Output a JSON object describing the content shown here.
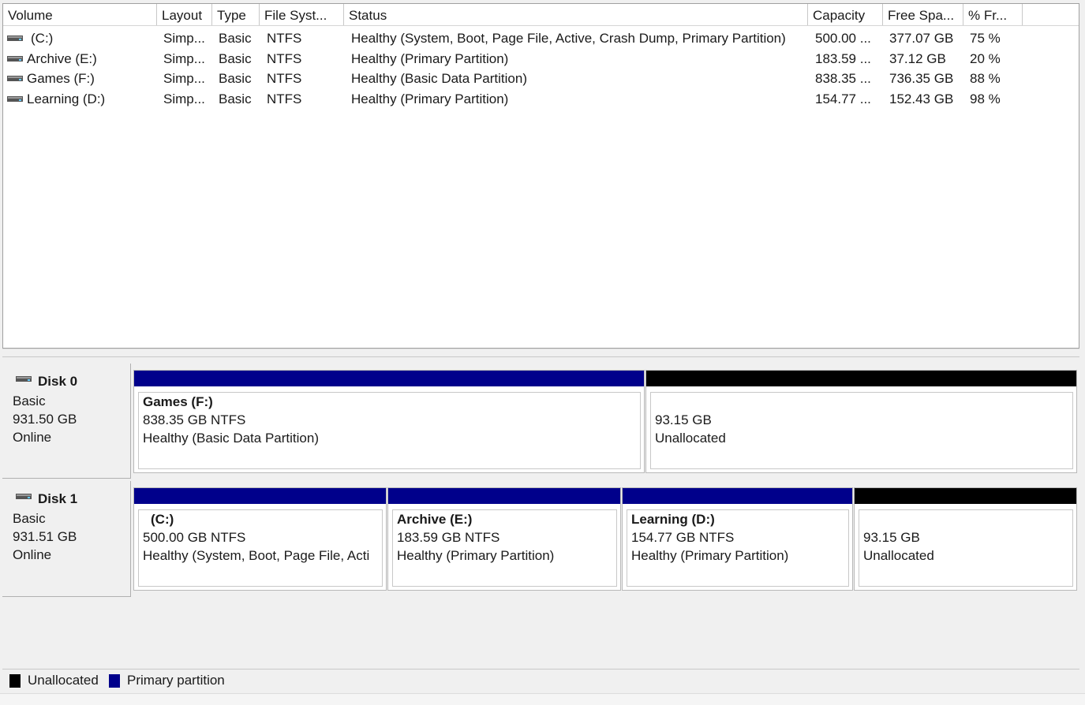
{
  "columns": [
    "Volume",
    "Layout",
    "Type",
    "File Syst...",
    "Status",
    "Capacity",
    "Free Spa...",
    "% Fr..."
  ],
  "volumes": [
    {
      "volume": "(C:)",
      "layout": "Simp...",
      "type": "Basic",
      "fs": "NTFS",
      "status": "Healthy (System, Boot, Page File, Active, Crash Dump, Primary Partition)",
      "capacity": "500.00 ...",
      "free": "377.07 GB",
      "pct": "75 %"
    },
    {
      "volume": "Archive (E:)",
      "layout": "Simp...",
      "type": "Basic",
      "fs": "NTFS",
      "status": "Healthy (Primary Partition)",
      "capacity": "183.59 ...",
      "free": "37.12 GB",
      "pct": "20 %"
    },
    {
      "volume": "Games (F:)",
      "layout": "Simp...",
      "type": "Basic",
      "fs": "NTFS",
      "status": "Healthy (Basic Data Partition)",
      "capacity": "838.35 ...",
      "free": "736.35 GB",
      "pct": "88 %"
    },
    {
      "volume": "Learning (D:)",
      "layout": "Simp...",
      "type": "Basic",
      "fs": "NTFS",
      "status": "Healthy (Primary Partition)",
      "capacity": "154.77 ...",
      "free": "152.43 GB",
      "pct": "98 %"
    }
  ],
  "disks": [
    {
      "name": "Disk 0",
      "type": "Basic",
      "size": "931.50 GB",
      "state": "Online",
      "partitions": [
        {
          "name": "Games  (F:)",
          "size": "838.35 GB NTFS",
          "status": "Healthy (Basic Data Partition)",
          "kind": "primary"
        },
        {
          "name": "",
          "size": "93.15 GB",
          "status": "Unallocated",
          "kind": "unallocated"
        }
      ]
    },
    {
      "name": "Disk 1",
      "type": "Basic",
      "size": "931.51 GB",
      "state": "Online",
      "partitions": [
        {
          "name": "(C:)",
          "size": "500.00 GB NTFS",
          "status": "Healthy (System, Boot, Page File, Acti",
          "kind": "primary"
        },
        {
          "name": "Archive  (E:)",
          "size": "183.59 GB NTFS",
          "status": "Healthy (Primary Partition)",
          "kind": "primary"
        },
        {
          "name": "Learning  (D:)",
          "size": "154.77 GB NTFS",
          "status": "Healthy (Primary Partition)",
          "kind": "primary"
        },
        {
          "name": "",
          "size": "93.15 GB",
          "status": "Unallocated",
          "kind": "unallocated"
        }
      ]
    }
  ],
  "legend": {
    "unallocated": "Unallocated",
    "primary": "Primary partition"
  },
  "colors": {
    "primary": "#00008b",
    "unallocated": "#000000"
  }
}
